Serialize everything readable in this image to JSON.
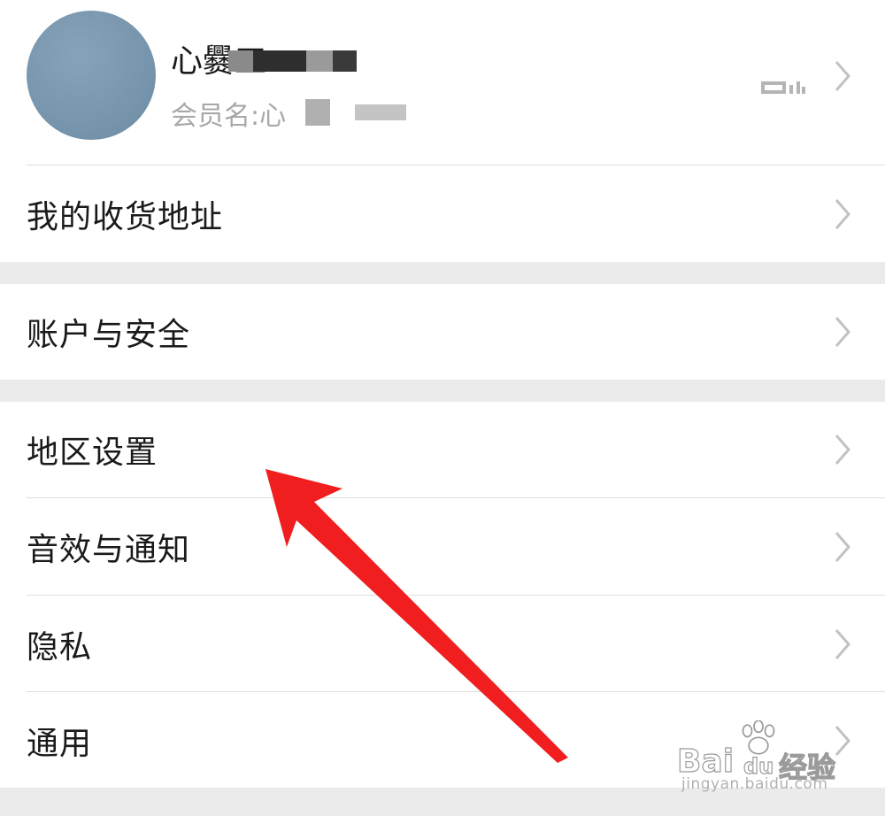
{
  "profile": {
    "name": "心爨工",
    "member_label": "会员名:心",
    "qr_icon": "qr-code-icon",
    "chevron_icon": "chevron-right-icon"
  },
  "groups": [
    {
      "items": [
        {
          "label": "我的收货地址"
        }
      ]
    },
    {
      "items": [
        {
          "label": "账户与安全"
        }
      ]
    },
    {
      "items": [
        {
          "label": "地区设置"
        },
        {
          "label": "音效与通知"
        },
        {
          "label": "隐私"
        },
        {
          "label": "通用"
        }
      ]
    }
  ],
  "watermark": {
    "brand": "Bai",
    "brand_du": "du",
    "brand_cn": "经验",
    "url": "jingyan.baidu.com"
  },
  "colors": {
    "background": "#ebebeb",
    "card": "#ffffff",
    "arrow": "#f01e1e",
    "avatar": "#7896ad"
  }
}
